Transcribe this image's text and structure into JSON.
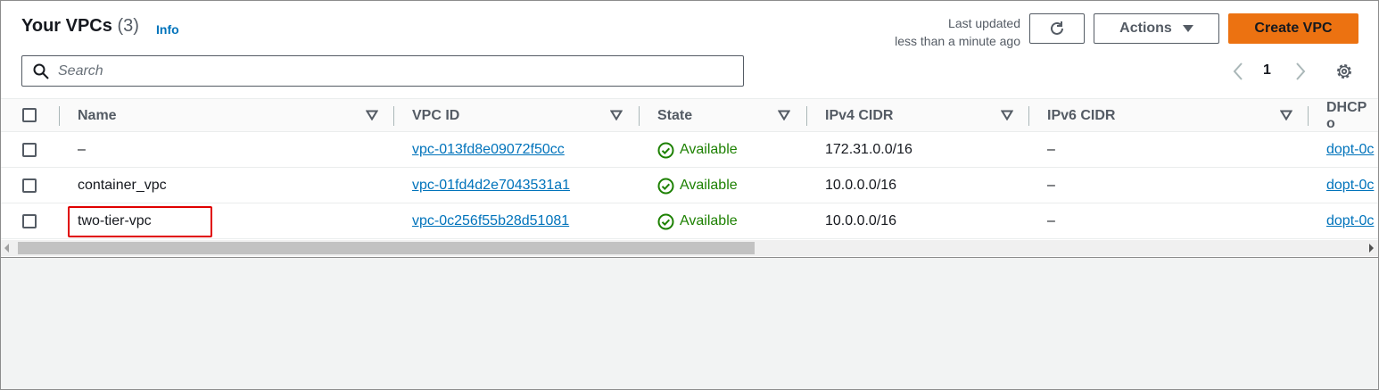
{
  "header": {
    "title": "Your VPCs",
    "count": "(3)",
    "info_label": "Info",
    "last_updated_line1": "Last updated",
    "last_updated_line2": "less than a minute ago",
    "actions_label": "Actions",
    "create_label": "Create VPC"
  },
  "search": {
    "placeholder": "Search",
    "value": ""
  },
  "pagination": {
    "current_page": "1"
  },
  "table": {
    "columns": [
      "Name",
      "VPC ID",
      "State",
      "IPv4 CIDR",
      "IPv6 CIDR",
      "DHCP o"
    ],
    "rows": [
      {
        "name": "–",
        "vpc_id": "vpc-013fd8e09072f50cc",
        "state": "Available",
        "ipv4": "172.31.0.0/16",
        "ipv6": "–",
        "dhcp": "dopt-0c"
      },
      {
        "name": "container_vpc",
        "vpc_id": "vpc-01fd4d2e7043531a1",
        "state": "Available",
        "ipv4": "10.0.0.0/16",
        "ipv6": "–",
        "dhcp": "dopt-0c"
      },
      {
        "name": "two-tier-vpc",
        "vpc_id": "vpc-0c256f55b28d51081",
        "state": "Available",
        "ipv4": "10.0.0.0/16",
        "ipv6": "–",
        "dhcp": "dopt-0c"
      }
    ]
  },
  "colors": {
    "accent": "#0073bb",
    "primary_button": "#ec7211",
    "status_available": "#1d8102",
    "highlight": "#e00000"
  },
  "icons": [
    "search-icon",
    "refresh-icon",
    "caret-down-icon",
    "chevron-left-icon",
    "chevron-right-icon",
    "settings-gear-icon",
    "sort-icon",
    "check-circle-icon"
  ]
}
